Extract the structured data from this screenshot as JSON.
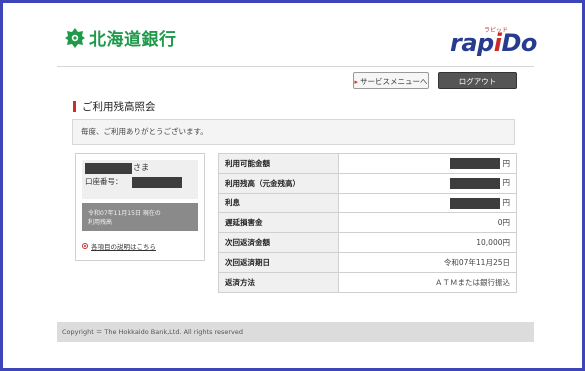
{
  "colors": {
    "frame": "#3e45b8",
    "brand_green": "#1e9a4a",
    "rapido_blue": "#273c8e",
    "accent_red": "#c9302c"
  },
  "header": {
    "bank_name": "北海道銀行",
    "rapido_small": "ラピッド",
    "rapido_pre": "rap",
    "rapido_red": "i",
    "rapido_post": "Do"
  },
  "actions": {
    "service_menu": "サービスメニューへ",
    "logout": "ログアウト"
  },
  "page": {
    "title": "ご利用残高照会",
    "greeting": "毎度、ご利用ありがとうございます。"
  },
  "customer": {
    "suffix": "さま",
    "account_label": "口座番号：",
    "date_note_line1": "令和07年11月15日 現在の",
    "date_note_line2": "利用残高",
    "help_link": "各項目の説明はこちら"
  },
  "details": [
    {
      "label": "利用可能金額",
      "value": "円",
      "redacted": true
    },
    {
      "label": "利用残高（元金残高）",
      "value": "円",
      "redacted": true
    },
    {
      "label": "利息",
      "value": "円",
      "redacted": true
    },
    {
      "label": "遅延損害金",
      "value": "0円",
      "redacted": false
    },
    {
      "label": "次回返済金額",
      "value": "10,000円",
      "redacted": false
    },
    {
      "label": "次回返済期日",
      "value": "令和07年11月25日",
      "redacted": false
    },
    {
      "label": "返済方法",
      "value": "ＡＴＭまたは銀行振込",
      "redacted": false
    }
  ],
  "footer": {
    "copyright": "Copyright ＝ The Hokkaido Bank,Ltd. All rights reserved"
  }
}
